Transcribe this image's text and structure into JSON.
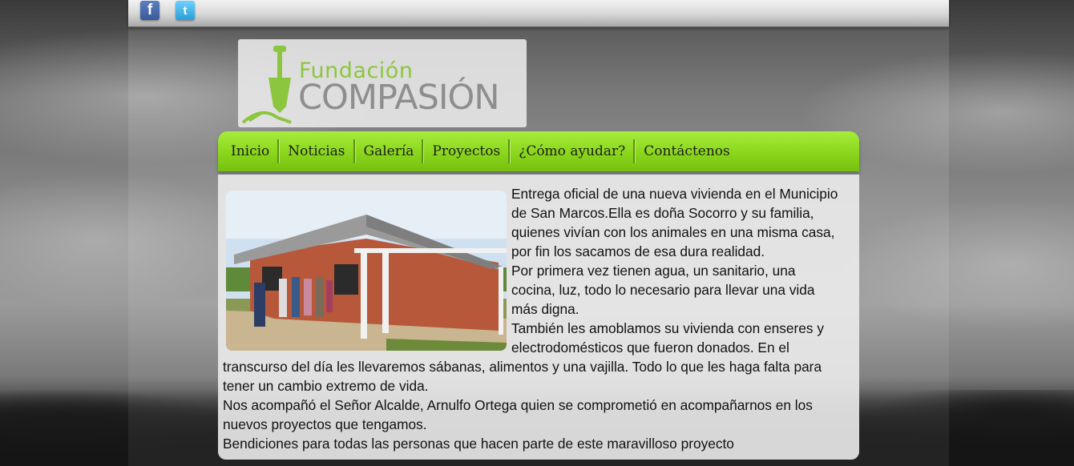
{
  "social": {
    "facebook_icon": "facebook-icon",
    "twitter_icon": "twitter-icon",
    "facebook_glyph": "f",
    "twitter_glyph": "t"
  },
  "logo": {
    "line1": "Fundación",
    "line2": "COMPASIÓN",
    "colors": {
      "accent": "#8cc63f",
      "gray": "#8e8e8e"
    }
  },
  "nav": {
    "items": [
      "Inicio",
      "Noticias",
      "Galería",
      "Proyectos",
      "¿Cómo ayudar?",
      "Contáctenos"
    ],
    "colors": {
      "top": "#a6ec3c",
      "bottom": "#76c010"
    }
  },
  "article": {
    "image_alt": "Nueva vivienda de ladrillo con familia frente a la casa",
    "paragraphs": [
      "Entrega oficial de una nueva vivienda en el Municipio de San Marcos.Ella es doña Socorro y su familia, quienes vivían con los animales en una misma casa, por fin los sacamos de esa dura realidad.",
      "Por primera vez tienen agua, un sanitario, una cocina, luz, todo lo necesario para llevar una vida más digna.",
      "También les amoblamos su vivienda con enseres y electrodomésticos que fueron donados. En el transcurso del día les llevaremos sábanas, alimentos y una vajilla. Todo lo que les haga falta para tener un cambio extremo de vida.",
      "Nos acompañó el Señor Alcalde, Arnulfo Ortega quien se comprometió en acompañarnos en los nuevos proyectos que tengamos.",
      "Bendiciones para todas las personas que hacen parte de este maravilloso proyecto"
    ]
  }
}
